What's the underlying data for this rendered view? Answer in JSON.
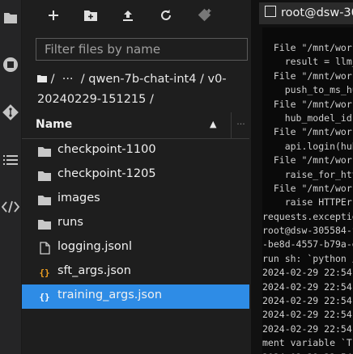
{
  "activity_bar": {
    "icons": [
      "folder-icon",
      "running-icon",
      "git-icon",
      "table-of-contents-icon",
      "extension-code-icon"
    ]
  },
  "toolbar": {
    "buttons": [
      "new-launcher-button",
      "new-folder-button",
      "upload-button",
      "refresh-button",
      "git-clone-button"
    ]
  },
  "filter": {
    "placeholder": "Filter files by name"
  },
  "breadcrumb": {
    "line1": " /  ···  / qwen-7b-chat-int4 / v0-",
    "line2": "20240229-151215 /"
  },
  "file_list": {
    "header": "Name",
    "items": [
      {
        "name": "checkpoint-1100",
        "icon": "folder-icon"
      },
      {
        "name": "checkpoint-1205",
        "icon": "folder-icon"
      },
      {
        "name": "images",
        "icon": "folder-icon"
      },
      {
        "name": "runs",
        "icon": "folder-icon"
      },
      {
        "name": "logging.jsonl",
        "icon": "file-icon"
      },
      {
        "name": "sft_args.json",
        "icon": "json-file-icon"
      },
      {
        "name": "training_args.json",
        "icon": "json-file-icon",
        "selected": true
      }
    ]
  },
  "terminal": {
    "tab_title": "root@dsw-305",
    "lines": [
      "  File \"/mnt/worksp",
      "    result = llm_x",
      "  File \"/mnt/worksp",
      "    push_to_ms_hub",
      "  File \"/mnt/worksp",
      "    hub_model_id =",
      "  File \"/mnt/worksp",
      "    api.login(hub_t",
      "  File \"/mnt/worksp",
      "    raise_for_http_",
      "  File \"/mnt/worksp",
      "    raise HTTPError",
      "requests.exceptions",
      "root@dsw-305584-f7",
      "-be8d-4557-b79a-e1",
      "run sh: `python /mn",
      "2024-02-29 22:54:5",
      "2024-02-29 22:54:5",
      "2024-02-29 22:54:5",
      "2024-02-29 22:54:5",
      "2024-02-29 22:54:5",
      "ment variable `TF_",
      "2024-02-29 22:54:5"
    ]
  },
  "colors": {
    "selection": "#2e8ce6",
    "json_icon": "#f0a020",
    "background": "#1e1e1e"
  }
}
